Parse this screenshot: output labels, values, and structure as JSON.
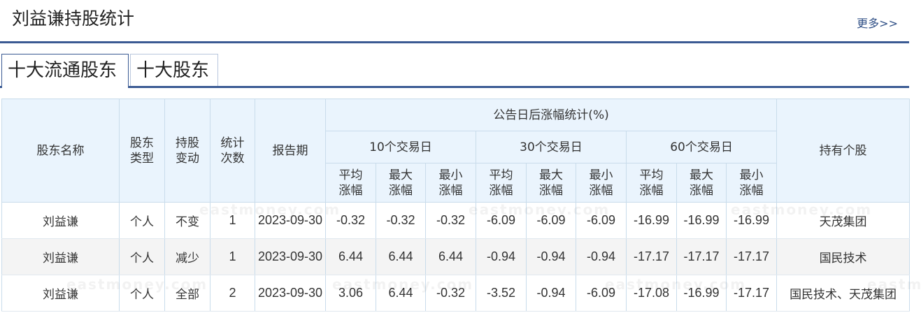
{
  "header": {
    "title": "刘益谦持股统计",
    "more_label": "更多>>"
  },
  "tabs": [
    {
      "label": "十大流通股东",
      "active": true
    },
    {
      "label": "十大股东",
      "active": false
    }
  ],
  "table": {
    "group_header": "公告日后涨幅统计(%)",
    "col_headers": {
      "name": "股东名称",
      "type": "股东\n类型",
      "change": "持股\n变动",
      "count": "统计\n次数",
      "period": "报告期",
      "holdings": "持有个股"
    },
    "periods": [
      "10个交易日",
      "30个交易日",
      "60个交易日"
    ],
    "sub_headers": [
      "平均\n涨幅",
      "最大\n涨幅",
      "最小\n涨幅"
    ],
    "rows": [
      {
        "name": "刘益谦",
        "type": "个人",
        "change": "不变",
        "count": "1",
        "period": "2023-09-30",
        "values": [
          "-0.32",
          "-0.32",
          "-0.32",
          "-6.09",
          "-6.09",
          "-6.09",
          "-16.99",
          "-16.99",
          "-16.99"
        ],
        "holdings": "天茂集团"
      },
      {
        "name": "刘益谦",
        "type": "个人",
        "change": "减少",
        "count": "1",
        "period": "2023-09-30",
        "values": [
          "6.44",
          "6.44",
          "6.44",
          "-0.94",
          "-0.94",
          "-0.94",
          "-17.17",
          "-17.17",
          "-17.17"
        ],
        "holdings": "国民技术"
      },
      {
        "name": "刘益谦",
        "type": "个人",
        "change": "全部",
        "count": "2",
        "period": "2023-09-30",
        "values": [
          "3.06",
          "6.44",
          "-0.32",
          "-3.52",
          "-0.94",
          "-6.09",
          "-17.08",
          "-16.99",
          "-17.17"
        ],
        "holdings": "国民技术、天茂集团"
      }
    ]
  },
  "colors": {
    "accent": "#3a5a93",
    "header_bg": "#eaf4fd",
    "up": "#e02020",
    "down": "#1a8a1a"
  },
  "watermark_text": "eastmoney.com"
}
